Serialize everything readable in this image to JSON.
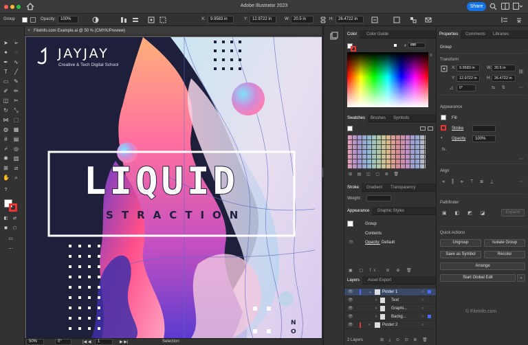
{
  "app": {
    "title": "Adobe Illustrator 2023",
    "share_label": "Share"
  },
  "control_bar": {
    "selection_label": "Group",
    "opacity_label": "Opacity:",
    "opacity_value": "100%",
    "x_label": "X:",
    "x_value": "9.9583 in",
    "y_label": "Y:",
    "y_value": "12.9722 in",
    "w_label": "W:",
    "w_value": "20.5 in",
    "h_label": "H:",
    "h_value": "26.4722 in"
  },
  "document": {
    "tab_title": "FileInfo.com Example.ai @ 50 % (CMYK/Preview)"
  },
  "artwork": {
    "logo_text": "JAYJAY",
    "tagline": "Creative & Tech Digital School",
    "headline": "LIQUID",
    "subhead": "ABSTRACTION",
    "corner_letters": "NO"
  },
  "status_bar": {
    "zoom": "50%",
    "rotation": "0°",
    "artboard_number": "1",
    "tool": "Selection"
  },
  "color_panel": {
    "tabs": [
      "Color",
      "Color Guide"
    ],
    "hex_value": "ffffff"
  },
  "swatches_panel": {
    "tabs": [
      "Swatches",
      "Brushes",
      "Symbols"
    ]
  },
  "stroke_panel": {
    "tabs": [
      "Stroke",
      "Gradient",
      "Transparency"
    ],
    "weight_label": "Weight:"
  },
  "appearance_panel": {
    "tabs": [
      "Appearance",
      "Graphic Styles"
    ],
    "item_label": "Group",
    "contents_label": "Contents",
    "opacity_label": "Opacity:",
    "opacity_value": "Default"
  },
  "layers_panel": {
    "tabs": [
      "Layers",
      "Asset Export"
    ],
    "rows": [
      "Poster 1",
      "Text",
      "Graphi...",
      "Backg...",
      "Poster 2"
    ],
    "count": "2 Layers"
  },
  "properties_panel": {
    "tabs": [
      "Properties",
      "Comments",
      "Libraries"
    ],
    "selection": "Group",
    "transform": {
      "heading": "Transform",
      "x_label": "X:",
      "x_value": "9.9583 in",
      "y_label": "Y:",
      "y_value": "12.9722 in",
      "w_label": "W:",
      "w_value": "20.5 in",
      "h_label": "H:",
      "h_value": "26.4722 in",
      "angle_value": "0°"
    },
    "appearance": {
      "heading": "Appearance",
      "fill_label": "Fill",
      "stroke_label": "Stroke",
      "opacity_label": "Opacity",
      "opacity_value": "100%",
      "fx_label": "fx."
    },
    "align_heading": "Align",
    "pathfinder_heading": "Pathfinder",
    "expand_label": "Expand",
    "quick_actions": {
      "heading": "Quick Actions",
      "ungroup": "Ungroup",
      "isolate_group": "Isolate Group",
      "save_as_symbol": "Save as Symbol",
      "recolor": "Recolor",
      "arrange": "Arrange",
      "start_global_edit": "Start Global Edit"
    }
  },
  "watermark": "© FileInfo.com",
  "colors": {
    "accent": "#1473e6",
    "chrome": "#323232",
    "artboard_bg": "#1d1f3b",
    "pink": "#ff4f8b",
    "purple": "#6a3cc8"
  }
}
